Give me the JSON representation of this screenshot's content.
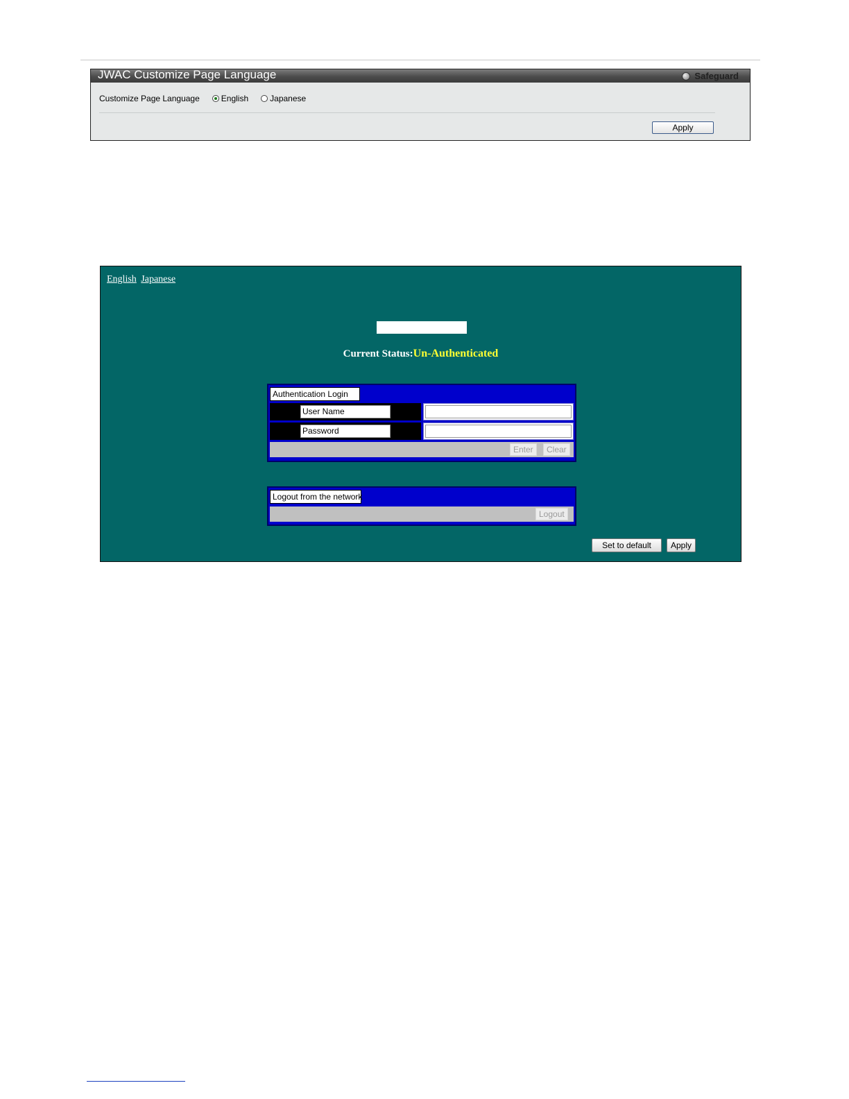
{
  "panel1": {
    "title": "JWAC Customize Page Language",
    "safeguard": "Safeguard",
    "lang_label": "Customize Page Language",
    "options": [
      {
        "label": "English",
        "selected": true
      },
      {
        "label": "Japanese",
        "selected": false
      }
    ],
    "apply": "Apply"
  },
  "panel2": {
    "links": [
      "English",
      "Japanese"
    ],
    "status_label": "Current Status:",
    "status_value": "Un-Authenticated",
    "auth_title": "Authentication Login",
    "username_label": "User Name",
    "password_label": "Password",
    "username_value": "",
    "password_value": "",
    "enter": "Enter",
    "clear": "Clear",
    "logout_title": "Logout from the network",
    "logout": "Logout",
    "set_default": "Set to default",
    "apply": "Apply"
  },
  "colors": {
    "panel2_bg": "#036666",
    "box_blue": "#0000cc",
    "status_yellow": "#ffff33"
  }
}
